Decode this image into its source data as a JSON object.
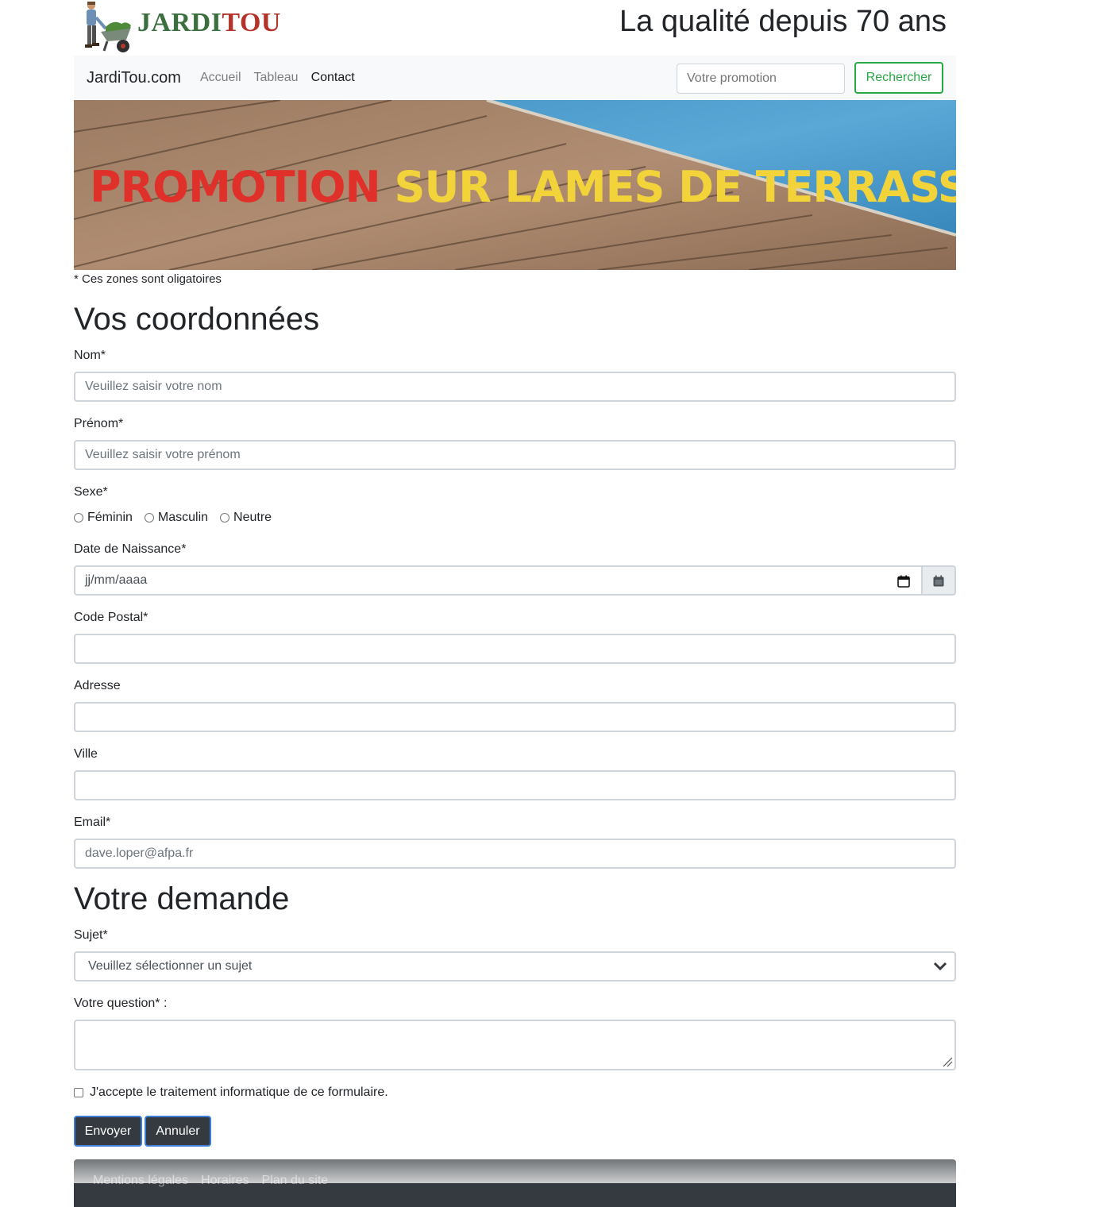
{
  "header": {
    "logo_text_1": "JARDI",
    "logo_text_2": "TOU",
    "tagline": "La qualité depuis 70 ans"
  },
  "navbar": {
    "brand": "JardiTou.com",
    "links": [
      {
        "label": "Accueil"
      },
      {
        "label": "Tableau"
      },
      {
        "label": "Contact"
      }
    ],
    "search_placeholder": "Votre promotion",
    "search_button": "Rechercher"
  },
  "banner": {
    "title_red": "PROMOTION",
    "title_yellow": "SUR LAMES DE TERRASSE"
  },
  "form": {
    "required_note": "* Ces zones sont oligatoires",
    "section1_title": "Vos coordonnées",
    "nom_label": "Nom*",
    "nom_placeholder": "Veuillez saisir votre nom",
    "prenom_label": "Prénom*",
    "prenom_placeholder": "Veuillez saisir votre prénom",
    "sexe_label": "Sexe*",
    "sexe_options": [
      "Féminin",
      "Masculin",
      "Neutre"
    ],
    "date_label": "Date de Naissance*",
    "date_placeholder": "jj/mm/aaaa",
    "cp_label": "Code Postal*",
    "adresse_label": "Adresse",
    "ville_label": "Ville",
    "email_label": "Email*",
    "email_placeholder": "dave.loper@afpa.fr",
    "section2_title": "Votre demande",
    "sujet_label": "Sujet*",
    "sujet_selected": "Veuillez sélectionner un sujet",
    "question_label": "Votre question* :",
    "accept_label": "J'accepte le traitement informatique de ce formulaire.",
    "submit_button": "Envoyer",
    "cancel_button": "Annuler"
  },
  "footer": {
    "links": [
      {
        "label": "Mentions légales"
      },
      {
        "label": "Horaires"
      },
      {
        "label": "Plan du site"
      }
    ]
  },
  "colors": {
    "success": "#28a745",
    "dark": "#343a40",
    "promo_red": "#e0302a",
    "promo_yellow": "#f2d43a"
  }
}
